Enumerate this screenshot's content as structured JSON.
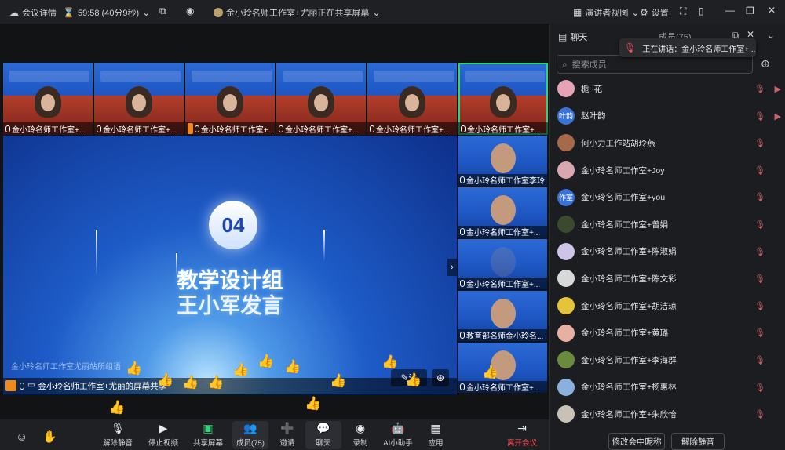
{
  "topbar": {
    "meeting_details": "会议详情",
    "timer": "59:58 (40分9秒)",
    "sharing_status": "金小玲名师工作室+尤丽正在共享屏幕",
    "view_label": "演讲者视图",
    "settings_label": "设置"
  },
  "video_strip": [
    {
      "name": "金小玲名师工作室+..."
    },
    {
      "name": "金小玲名师工作室+..."
    },
    {
      "name": "金小玲名师工作室+..."
    },
    {
      "name": "金小玲名师工作室+..."
    },
    {
      "name": "金小玲名师工作室+..."
    },
    {
      "name": "金小玲名师工作室+..."
    }
  ],
  "right_column": [
    {
      "name": "金小玲名师工作室李玲"
    },
    {
      "name": "金小玲名师工作室+..."
    },
    {
      "name": "金小玲名师工作室+..."
    },
    {
      "name": "教育部名师金小玲名..."
    },
    {
      "name": "金小玲名师工作室+..."
    }
  ],
  "shared_screen": {
    "number": "04",
    "title_line1": "教学设计组",
    "title_line2": "王小军发言",
    "caption": "金小玲名师工作室尤丽站所组语",
    "presenter_label": "金小玲名师工作室+尤丽的屏幕共享",
    "annotate_label": "注"
  },
  "bottombar": {
    "mute": "解除静音",
    "stop_video": "停止视频",
    "share": "共享屏幕",
    "members": "成员(75)",
    "invite": "邀请",
    "chat": "聊天",
    "record": "录制",
    "ai": "AI小助手",
    "apps": "应用",
    "leave": "离开会议"
  },
  "panel": {
    "chat_tab": "聊天",
    "members_tab": "成员(75)",
    "search_placeholder": "搜索成员",
    "speaking_toast": "正在讲话：金小玲名师工作室+...",
    "rename_button": "修改会中昵称",
    "unmute_button": "解除静音",
    "members": [
      {
        "name": "栀~花",
        "avatar": "",
        "color": "#e5a3b6",
        "camera": true
      },
      {
        "name": "赵叶韵",
        "avatar": "叶韵",
        "color": "#3a73d8",
        "camera": true
      },
      {
        "name": "何小力工作站胡玲燕",
        "avatar": "",
        "color": "#a46a4a",
        "camera": false
      },
      {
        "name": "金小玲名师工作室+Joy",
        "avatar": "",
        "color": "#d9a7b0",
        "camera": false
      },
      {
        "name": "金小玲名师工作室+you",
        "avatar": "作室",
        "color": "#3a73d8",
        "camera": false
      },
      {
        "name": "金小玲名师工作室+曾娟",
        "avatar": "",
        "color": "#3b4a2e",
        "camera": false
      },
      {
        "name": "金小玲名师工作室+陈淑娟",
        "avatar": "",
        "color": "#cfc3e8",
        "camera": false
      },
      {
        "name": "金小玲名师工作室+陈文彩",
        "avatar": "",
        "color": "#d8d8d8",
        "camera": false
      },
      {
        "name": "金小玲名师工作室+胡洁琼",
        "avatar": "",
        "color": "#e4c53a",
        "camera": false
      },
      {
        "name": "金小玲名师工作室+黄璐",
        "avatar": "",
        "color": "#e8b0a2",
        "camera": false
      },
      {
        "name": "金小玲名师工作室+李海群",
        "avatar": "",
        "color": "#6a8a3e",
        "camera": false
      },
      {
        "name": "金小玲名师工作室+杨惠林",
        "avatar": "",
        "color": "#8ab0e0",
        "camera": false
      },
      {
        "name": "金小玲名师工作室+朱欣怡",
        "avatar": "",
        "color": "#c9c0b6",
        "camera": false
      }
    ]
  },
  "colors": {
    "active_border": "#30d27a",
    "leave": "#ff4d4d",
    "accent": "#3a73d8"
  }
}
